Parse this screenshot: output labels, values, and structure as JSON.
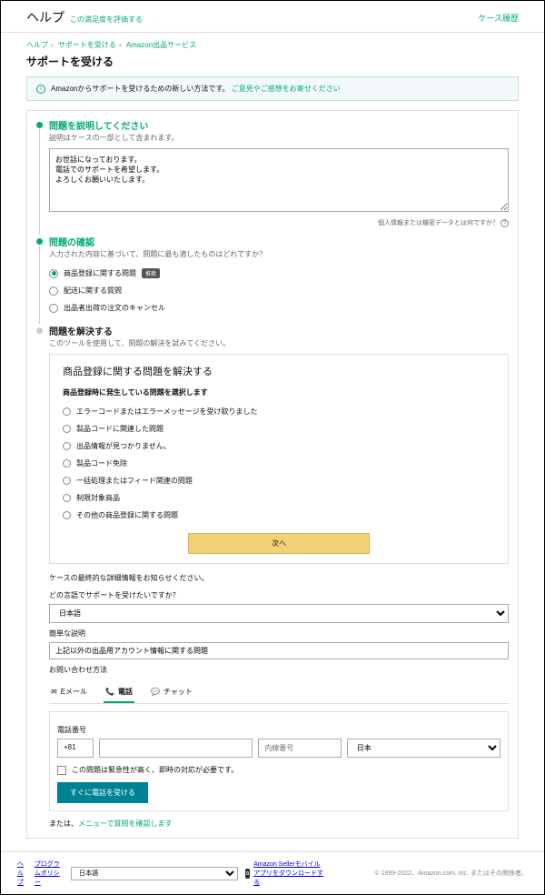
{
  "header": {
    "title": "ヘルプ",
    "rate_link": "この満足度を評価する",
    "case_history": "ケース履歴"
  },
  "breadcrumbs": [
    "ヘルプ",
    "サポートを受ける",
    "Amazon出品サービス"
  ],
  "page_title": "サポートを受ける",
  "alert": {
    "text": "Amazonからサポートを受けるための新しい方法です。",
    "link": "ご意見やご感想をお寄せください"
  },
  "steps": {
    "describe": {
      "title": "問題を説明してください",
      "sub": "説明はケースの一部として含まれます。",
      "value": "お世話になっております。\n電話でのサポートを希望します。\nよろしくお願いいたします。",
      "privacy": "個人情報または機密データとは何ですか？"
    },
    "confirm": {
      "title": "問題の確認",
      "sub": "入力された内容に基づいて、問題に最も適したものはどれですか？",
      "options": [
        {
          "label": "商品登録に関する問題",
          "badge": "推奨",
          "selected": true
        },
        {
          "label": "配送に関する質問",
          "selected": false
        },
        {
          "label": "出品者出荷の注文のキャンセル",
          "selected": false
        }
      ]
    },
    "resolve": {
      "title": "問題を解決する",
      "sub": "このツールを使用して、問題の解決を試みてください。"
    }
  },
  "solve": {
    "title": "商品登録に関する問題を解決する",
    "subtitle": "商品登録時に発生している問題を選択します",
    "options": [
      "エラーコードまたはエラーメッセージを受け取りました",
      "製品コードに関連した問題",
      "出品情報が見つかりません。",
      "製品コード免除",
      "一括処理またはフィード関連の問題",
      "制限対象商品",
      "その他の商品登録に関する問題"
    ],
    "next": "次へ"
  },
  "case": {
    "note": "ケースの最終的な詳細情報をお知らせください。",
    "lang_label": "どの言語でサポートを受けたいですか？",
    "lang_value": "日本語",
    "desc_label": "簡単な説明",
    "desc_value": "上記以外の出品用アカウント情報に関する問題",
    "contact_label": "お問い合わせ方法",
    "tabs": [
      {
        "icon": "✉",
        "label": "Eメール",
        "sel": false
      },
      {
        "icon": "📞",
        "label": "電話",
        "sel": true
      },
      {
        "icon": "💬",
        "label": "チャット",
        "sel": false
      }
    ],
    "phone": {
      "label": "電話番号",
      "cc": "+81",
      "ext_ph": "内線番号",
      "country": "日本"
    },
    "urgent": "この問題は緊急性が高く、即時の対応が必要です。",
    "cta": "すぐに電話を受ける",
    "alt": {
      "pre": "または、",
      "link": "メニューで質問を確認します"
    }
  },
  "footer": {
    "help": "ヘルプ",
    "policy": "プログラムポリシー",
    "lang": "日本語",
    "app": "Amazon Sellerモバイルアプリをダウンロードする",
    "copyright": "© 1999-2022、Amazon.com, Inc. またはその関係者。"
  }
}
